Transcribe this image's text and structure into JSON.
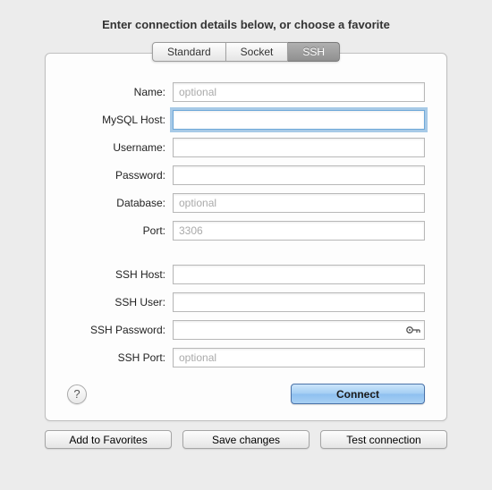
{
  "header": "Enter connection details below, or choose a favorite",
  "tabs": {
    "standard": "Standard",
    "socket": "Socket",
    "ssh": "SSH"
  },
  "fields": {
    "name": {
      "label": "Name:",
      "placeholder": "optional",
      "value": ""
    },
    "mysql_host": {
      "label": "MySQL Host:",
      "placeholder": "",
      "value": ""
    },
    "username": {
      "label": "Username:",
      "placeholder": "",
      "value": ""
    },
    "password": {
      "label": "Password:",
      "placeholder": "",
      "value": ""
    },
    "database": {
      "label": "Database:",
      "placeholder": "optional",
      "value": ""
    },
    "port": {
      "label": "Port:",
      "placeholder": "3306",
      "value": ""
    },
    "ssh_host": {
      "label": "SSH Host:",
      "placeholder": "",
      "value": ""
    },
    "ssh_user": {
      "label": "SSH User:",
      "placeholder": "",
      "value": ""
    },
    "ssh_password": {
      "label": "SSH Password:",
      "placeholder": "",
      "value": ""
    },
    "ssh_port": {
      "label": "SSH Port:",
      "placeholder": "optional",
      "value": ""
    }
  },
  "buttons": {
    "help": "?",
    "connect": "Connect",
    "add_favorites": "Add to Favorites",
    "save_changes": "Save changes",
    "test_connection": "Test connection"
  }
}
